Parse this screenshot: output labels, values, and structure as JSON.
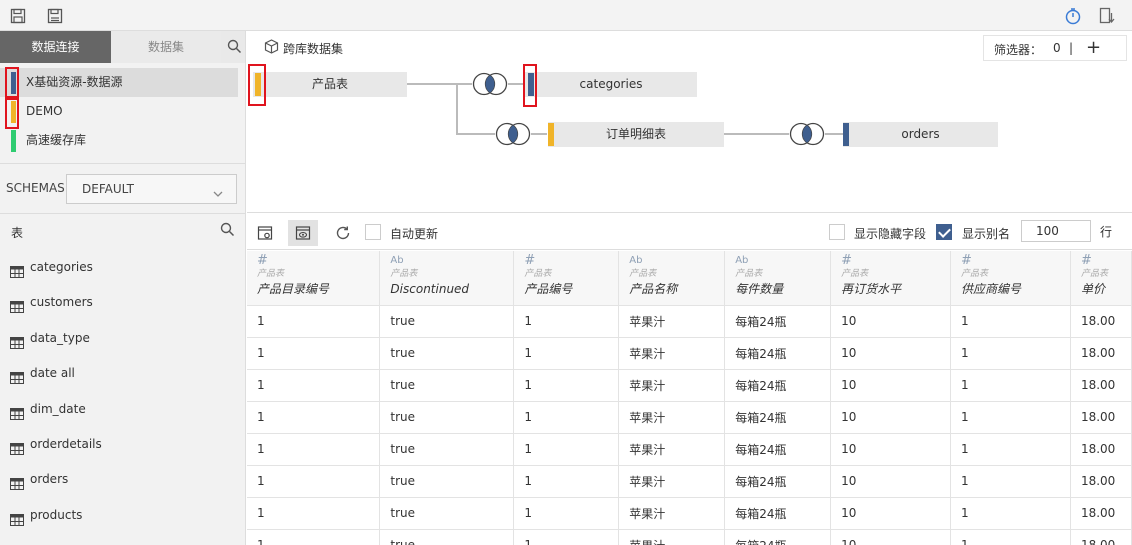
{
  "top": {
    "icons": [
      "save-icon",
      "save-as-icon",
      "timer-icon",
      "export-icon"
    ]
  },
  "sidebar": {
    "tabs": {
      "active": "数据连接",
      "inactive": "数据集"
    },
    "sources": [
      {
        "label": "X基础资源-数据源",
        "color": "#3f5f8f"
      },
      {
        "label": "DEMO",
        "color": "#f0b429"
      },
      {
        "label": "高速缓存库",
        "color": "#2ecc71"
      }
    ],
    "schemas": {
      "label": "SCHEMAS",
      "value": "DEFAULT"
    },
    "table_header": "表",
    "tables": [
      "categories",
      "customers",
      "data_type",
      "date all",
      "dim_date",
      "orderdetails",
      "orders",
      "products"
    ]
  },
  "canvas": {
    "title": "跨库数据集",
    "filter": {
      "label": "筛选器：",
      "count": "0",
      "sep": "|",
      "add": "+"
    },
    "nodes": {
      "products": {
        "label": "产品表",
        "color": "#f0b429"
      },
      "categories": {
        "label": "categories",
        "color": "#3f5f8f"
      },
      "orderdetails": {
        "label": "订单明细表",
        "color": "#f0b429"
      },
      "orders": {
        "label": "orders",
        "color": "#3f5f8f"
      }
    }
  },
  "toolbar": {
    "auto_update": "自动更新",
    "show_hidden": "显示隐藏字段",
    "show_alias": "显示别名",
    "rows_value": "100",
    "rows_unit": "行"
  },
  "grid": {
    "columns": [
      {
        "type": "#",
        "source": "产品表",
        "name": "产品目录编号"
      },
      {
        "type": "Ab",
        "source": "产品表",
        "name": "Discontinued"
      },
      {
        "type": "#",
        "source": "产品表",
        "name": "产品编号"
      },
      {
        "type": "Ab",
        "source": "产品表",
        "name": "产品名称"
      },
      {
        "type": "Ab",
        "source": "产品表",
        "name": "每件数量"
      },
      {
        "type": "#",
        "source": "产品表",
        "name": "再订货水平"
      },
      {
        "type": "#",
        "source": "产品表",
        "name": "供应商编号"
      },
      {
        "type": "#",
        "source": "产品表",
        "name": "单价"
      }
    ],
    "rows": [
      [
        "1",
        "true",
        "1",
        "苹果汁",
        "每箱24瓶",
        "10",
        "1",
        "18.00"
      ],
      [
        "1",
        "true",
        "1",
        "苹果汁",
        "每箱24瓶",
        "10",
        "1",
        "18.00"
      ],
      [
        "1",
        "true",
        "1",
        "苹果汁",
        "每箱24瓶",
        "10",
        "1",
        "18.00"
      ],
      [
        "1",
        "true",
        "1",
        "苹果汁",
        "每箱24瓶",
        "10",
        "1",
        "18.00"
      ],
      [
        "1",
        "true",
        "1",
        "苹果汁",
        "每箱24瓶",
        "10",
        "1",
        "18.00"
      ],
      [
        "1",
        "true",
        "1",
        "苹果汁",
        "每箱24瓶",
        "10",
        "1",
        "18.00"
      ],
      [
        "1",
        "true",
        "1",
        "苹果汁",
        "每箱24瓶",
        "10",
        "1",
        "18.00"
      ],
      [
        "1",
        "true",
        "1",
        "苹果汁",
        "每箱24瓶",
        "10",
        "1",
        "18.00"
      ]
    ]
  }
}
